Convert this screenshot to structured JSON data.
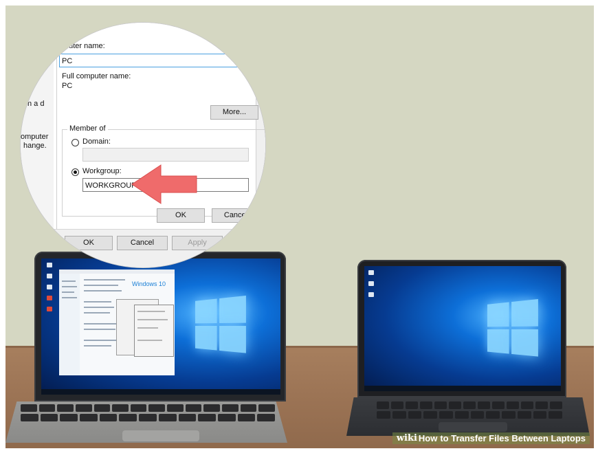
{
  "dialog": {
    "computer_name_label": "puter name:",
    "computer_name_value": "PC",
    "full_name_label": "Full computer name:",
    "full_name_value": "PC",
    "more_button": "More...",
    "member_of_label": "Member of",
    "domain_label": "Domain:",
    "domain_value": "",
    "workgroup_label": "Workgroup:",
    "workgroup_value": "WORKGROUP",
    "workgroup_selected": true,
    "ok_button": "OK",
    "cancel_button": "Cancel",
    "side_text_1": "n a d",
    "side_text_2": "omputer",
    "side_text_3": "hange."
  },
  "parent_dialog": {
    "ok_button": "OK",
    "cancel_button": "Cancel",
    "apply_button": "Apply"
  },
  "left_laptop": {
    "windows_badge": "Windows 10"
  },
  "watermark": {
    "brand": "wiki",
    "how": "How",
    "title": "to Transfer Files Between Laptops"
  },
  "colors": {
    "wall": "#d5d7c2",
    "table": "#a07a5a",
    "arrow": "#ef6b6b",
    "screen_blue": "#0d6fd8"
  }
}
